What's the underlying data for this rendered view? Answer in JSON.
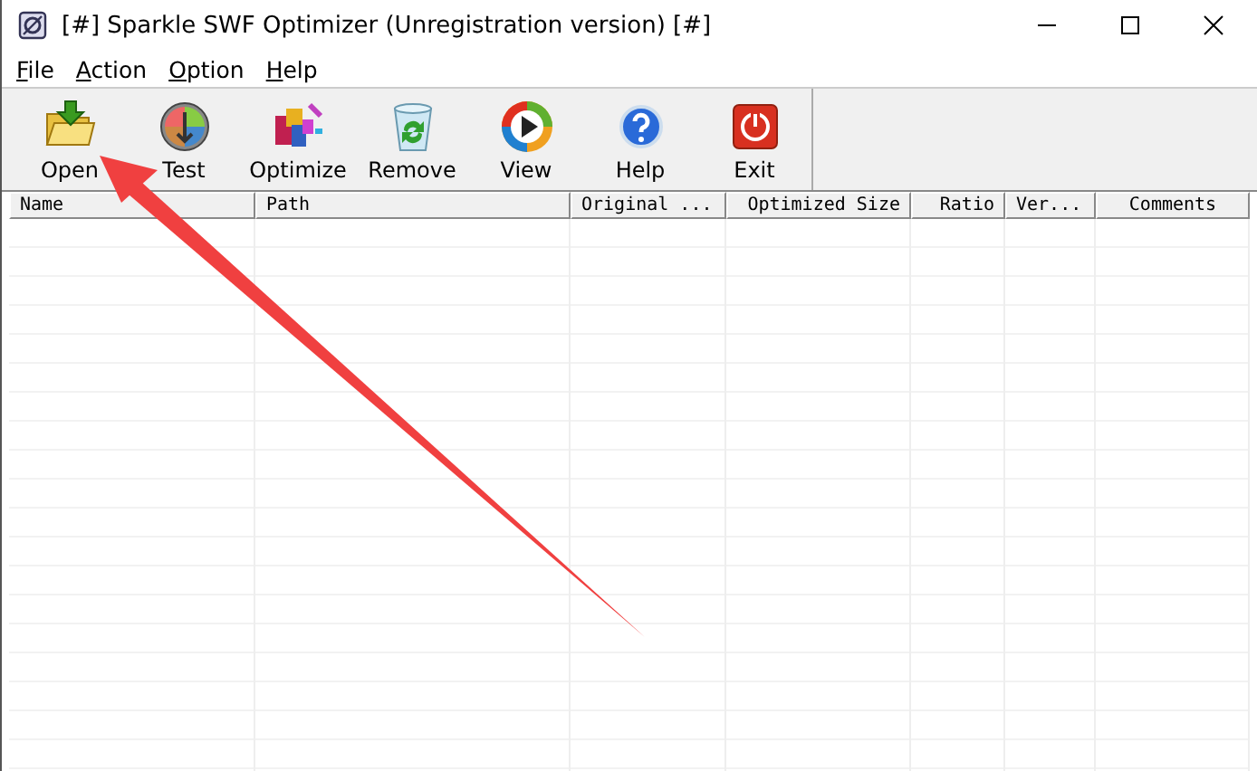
{
  "window": {
    "title": "[#] Sparkle SWF Optimizer (Unregistration version) [#]"
  },
  "menu": [
    "File",
    "Action",
    "Option",
    "Help"
  ],
  "toolbar": [
    {
      "kind": "open",
      "label": "Open"
    },
    {
      "kind": "test",
      "label": "Test"
    },
    {
      "kind": "optimize",
      "label": "Optimize"
    },
    {
      "kind": "remove",
      "label": "Remove"
    },
    {
      "kind": "view",
      "label": "View"
    },
    {
      "kind": "help",
      "label": "Help"
    },
    {
      "kind": "exit",
      "label": "Exit"
    }
  ],
  "table": {
    "columns": [
      {
        "label": "Name"
      },
      {
        "label": "Path"
      },
      {
        "label": "Original ..."
      },
      {
        "label": "Optimized Size"
      },
      {
        "label": "Ratio"
      },
      {
        "label": "Ver..."
      },
      {
        "label": "Comments"
      }
    ]
  }
}
